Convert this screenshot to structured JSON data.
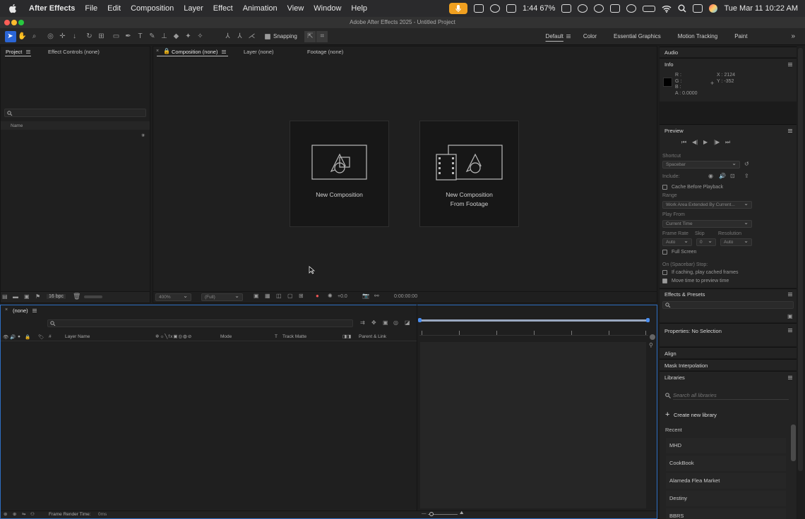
{
  "menubar": {
    "app_name": "After Effects",
    "items": [
      "File",
      "Edit",
      "Composition",
      "Layer",
      "Effect",
      "Animation",
      "View",
      "Window",
      "Help"
    ],
    "status": "1:44 67%",
    "datetime": "Tue Mar 11  10:22 AM"
  },
  "window": {
    "title": "Adobe After Effects 2025 - Untitled Project"
  },
  "toolbar": {
    "snapping_label": "Snapping",
    "workspaces": [
      "Default",
      "Color",
      "Essential Graphics",
      "Motion Tracking",
      "Paint"
    ],
    "active_workspace": "Default"
  },
  "project_panel": {
    "tabs": [
      "Project",
      "Effect Controls (none)"
    ],
    "column_name": "Name",
    "bpc": "16 bpc"
  },
  "viewer": {
    "tabs": [
      "Composition (none)",
      "Layer (none)",
      "Footage (none)"
    ],
    "card_new_comp": "New Composition",
    "card_from_footage_line1": "New Composition",
    "card_from_footage_line2": "From Footage",
    "zoom": "400%",
    "resolution": "(Full)",
    "exposure": "+0.0",
    "timecode": "0:00:00:00"
  },
  "timeline": {
    "tab": "(none)",
    "columns": {
      "layer_name": "Layer Name",
      "mode": "Mode",
      "t": "T",
      "track_matte": "Track Matte",
      "parent": "Parent & Link",
      "num": "#"
    },
    "render_time_label": "Frame Render Time:",
    "render_time_value": "0ms"
  },
  "right_panels": {
    "audio": "Audio",
    "info": {
      "title": "Info",
      "r": "R :",
      "g": "G :",
      "b": "B :",
      "a": "A :  0.0000",
      "x": "X : 2124",
      "y": "Y : -352"
    },
    "preview": {
      "title": "Preview",
      "shortcut_label": "Shortcut",
      "shortcut_value": "Spacebar",
      "include_label": "Include:",
      "cache_label": "Cache Before Playback",
      "range_label": "Range",
      "range_value": "Work Area Extended By Current...",
      "play_from_label": "Play From",
      "play_from_value": "Current Time",
      "frame_rate_label": "Frame Rate",
      "skip_label": "Skip",
      "resolution_label": "Resolution",
      "frame_rate_value": "Auto",
      "skip_value": "0",
      "resolution_value": "Auto",
      "full_screen_label": "Full Screen",
      "spacebar_stop_label": "On (Spacebar) Stop:",
      "if_caching_label": "If caching, play cached frames",
      "move_time_label": "Move time to preview time"
    },
    "effects_presets": "Effects & Presets",
    "properties": "Properties: No Selection",
    "align": "Align",
    "mask_interp": "Mask Interpolation",
    "libraries": {
      "title": "Libraries",
      "search_placeholder": "Search all libraries",
      "create_label": "Create new library",
      "recent_label": "Recent",
      "items": [
        "MHD",
        "CookBook",
        "Alameda Flea Market",
        "Destiny",
        "BBRS"
      ]
    }
  }
}
